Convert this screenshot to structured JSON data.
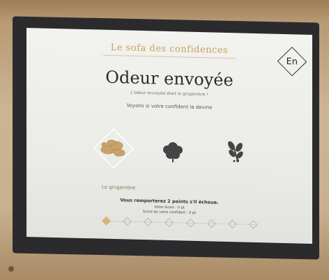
{
  "header": {
    "brand": "Le sofa des confidences",
    "language_button": "En"
  },
  "main": {
    "title": "Odeur envoyée",
    "subtitle": "L'odeur envoyée était le gingembre !",
    "prompt": "Voyons si votre confident la devine"
  },
  "choices": [
    {
      "label": "",
      "icon": "ginger-root-icon",
      "selected": true
    },
    {
      "label": "",
      "icon": "hibiscus-icon",
      "selected": false
    },
    {
      "label": "",
      "icon": "herb-sprig-icon",
      "selected": false
    }
  ],
  "selected_label": "Le gingembre",
  "score": {
    "headline": "Vous remporterez 2 points s'il échoue.",
    "line1": "Votre Score : 0 pt",
    "line2": "Score de votre confident : 0 pt"
  },
  "progress": {
    "total_steps": 8,
    "completed_steps": 1
  },
  "colors": {
    "accent_gold": "#c9a15a",
    "selected_fill": "#d8b27a",
    "screen_bg": "#f2f2ef"
  }
}
